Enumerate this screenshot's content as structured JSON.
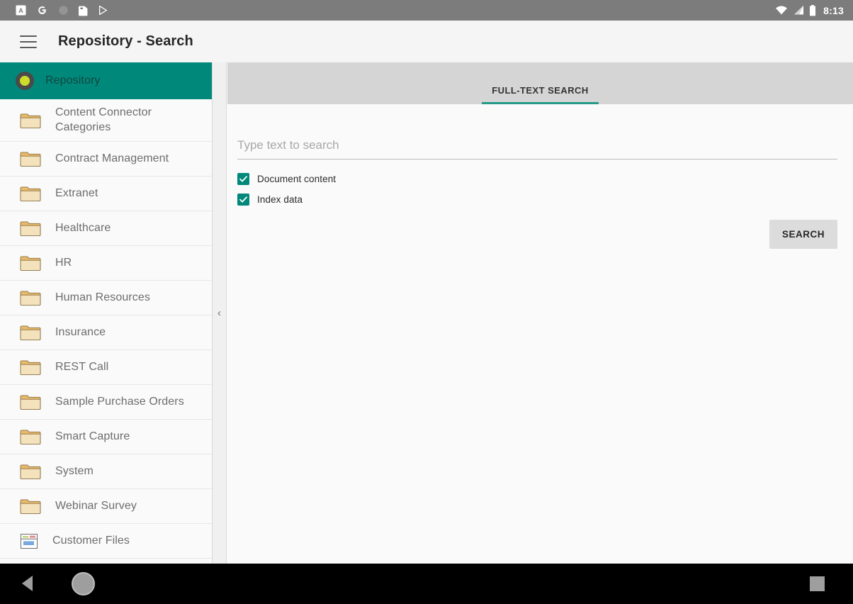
{
  "statusbar": {
    "notification_icons": [
      "app-a-icon",
      "google-g-icon",
      "circle-icon",
      "sim-card-icon",
      "play-store-icon"
    ],
    "wifi_icon": "wifi-icon",
    "signal_icon": "signal-icon",
    "battery_icon": "battery-icon",
    "time": "8:13"
  },
  "appbar": {
    "menu_icon": "hamburger-menu-icon",
    "title": "Repository - Search"
  },
  "sidebar": {
    "collapse_chevron": "‹",
    "items": [
      {
        "label": "Repository",
        "icon": "repository-icon",
        "type": "root",
        "selected": true
      },
      {
        "label": "Content Connector Categories",
        "icon": "folder-icon",
        "type": "folder",
        "tall": true
      },
      {
        "label": "Contract Management",
        "icon": "folder-icon",
        "type": "folder"
      },
      {
        "label": "Extranet",
        "icon": "folder-icon",
        "type": "folder"
      },
      {
        "label": "Healthcare",
        "icon": "folder-icon",
        "type": "folder"
      },
      {
        "label": "HR",
        "icon": "folder-icon",
        "type": "folder"
      },
      {
        "label": "Human Resources",
        "icon": "folder-icon",
        "type": "folder"
      },
      {
        "label": "Insurance",
        "icon": "folder-icon",
        "type": "folder"
      },
      {
        "label": "REST Call",
        "icon": "folder-icon",
        "type": "folder"
      },
      {
        "label": "Sample Purchase Orders",
        "icon": "folder-icon",
        "type": "folder"
      },
      {
        "label": "Smart Capture",
        "icon": "folder-icon",
        "type": "folder"
      },
      {
        "label": "System",
        "icon": "folder-icon",
        "type": "folder"
      },
      {
        "label": "Webinar Survey",
        "icon": "folder-icon",
        "type": "folder"
      },
      {
        "label": "Customer Files",
        "icon": "smart-folder-icon",
        "type": "smartfolder"
      }
    ]
  },
  "main": {
    "tabs": [
      {
        "label": "FULL-TEXT SEARCH",
        "active": true
      }
    ],
    "search": {
      "value": "",
      "placeholder": "Type text to search"
    },
    "checkboxes": [
      {
        "label": "Document content",
        "checked": true
      },
      {
        "label": "Index data",
        "checked": true
      }
    ],
    "search_button_label": "SEARCH"
  },
  "navbar": {
    "back_icon": "back-triangle-icon",
    "home_icon": "home-circle-icon",
    "recents_icon": "recents-square-icon"
  },
  "colors": {
    "accent_teal": "#00897b",
    "tab_underline": "#279989",
    "statusbar_bg": "#7c7c7c",
    "appbar_bg": "#f5f5f5",
    "tabbar_bg": "#d5d5d5",
    "folder_fill": "#f0dfb8",
    "repository_dot": "#cddc2a"
  }
}
